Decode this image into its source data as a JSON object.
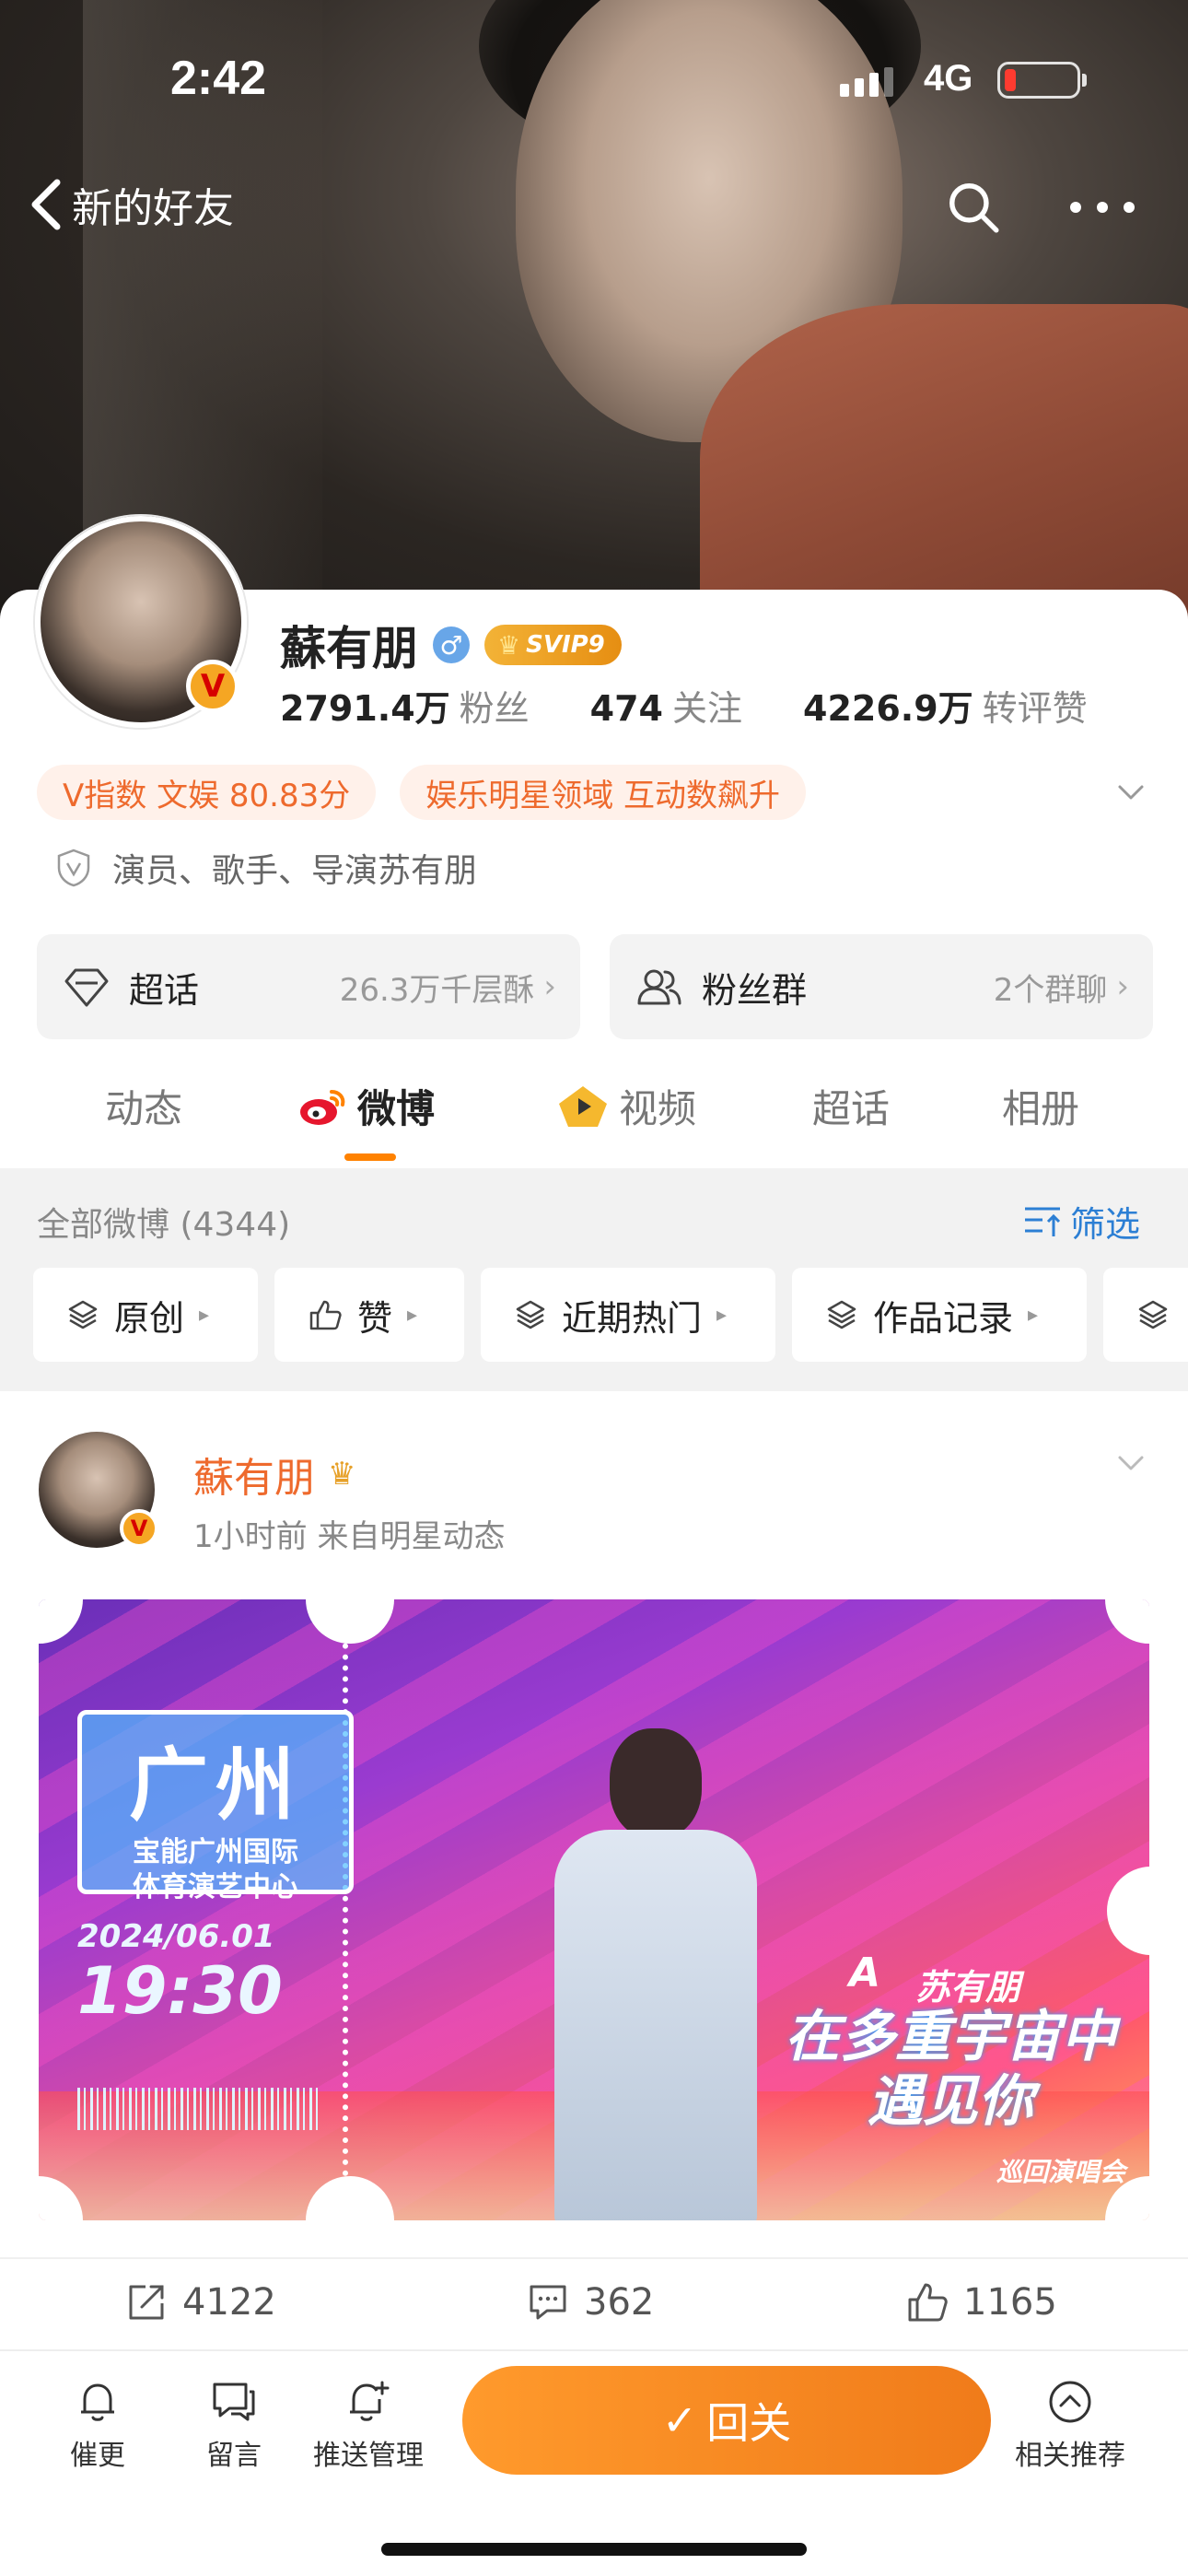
{
  "status_bar": {
    "time": "2:42",
    "network": "4G"
  },
  "nav": {
    "back_label": "新的好友"
  },
  "profile": {
    "name": "蘇有朋",
    "svip_label": "SVIP9",
    "stats": [
      {
        "value": "2791.4万",
        "label": "粉丝"
      },
      {
        "value": "474",
        "label": "关注"
      },
      {
        "value": "4226.9万",
        "label": "转评赞"
      }
    ],
    "tags": [
      "V指数 文娱 80.83分",
      "娱乐明星领域 互动数飙升"
    ],
    "bio": "演员、歌手、导演苏有朋",
    "boxes": [
      {
        "title": "超话",
        "aux": "26.3万千层酥"
      },
      {
        "title": "粉丝群",
        "aux": "2个群聊"
      }
    ]
  },
  "tabs": [
    {
      "label": "动态"
    },
    {
      "label": "微博"
    },
    {
      "label": "视频"
    },
    {
      "label": "超话"
    },
    {
      "label": "相册"
    }
  ],
  "feed": {
    "count_label": "全部微博 (4344)",
    "filter_label": "筛选",
    "chips": [
      "原创",
      "赞",
      "近期热门",
      "作品记录"
    ]
  },
  "post": {
    "author": "蘇有朋",
    "meta": "1小时前  来自明星动态",
    "poster": {
      "city": "广州",
      "venue_line1": "宝能广州国际",
      "venue_line2": "体育演艺中心",
      "date": "2024/06.01",
      "time": "19:30",
      "tour_prefix": "A",
      "tour_name": "苏有朋",
      "tour_title": "在多重宇宙中遇见你",
      "tour_sub": "巡回演唱会"
    },
    "actions": {
      "repost": "4122",
      "comment": "362",
      "like": "1165"
    }
  },
  "bottom_bar": {
    "items": [
      "催更",
      "留言",
      "推送管理",
      "相关推荐"
    ],
    "follow_label": "回关"
  },
  "colors": {
    "accent": "#FF8200",
    "brand_orange": "#EE6A2D",
    "link_blue": "#2C7FD4"
  }
}
